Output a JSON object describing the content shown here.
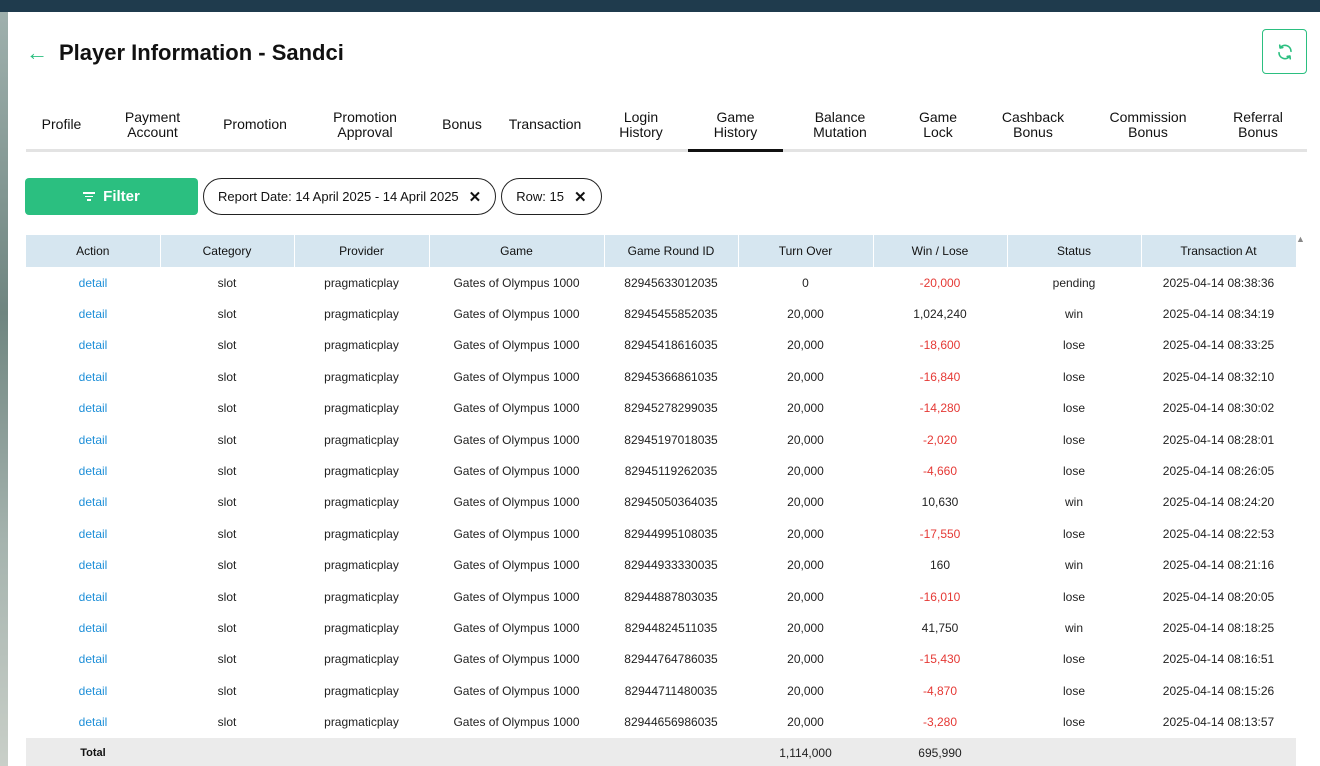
{
  "header": {
    "title": "Player Information - Sandci",
    "back_icon": "arrow-left-icon",
    "refresh_icon": "refresh-icon"
  },
  "tabs": [
    {
      "label": "Profile",
      "w": 71
    },
    {
      "label": "Payment\nAccount",
      "w": 111
    },
    {
      "label": "Promotion",
      "w": 94
    },
    {
      "label": "Promotion\nApproval",
      "w": 126
    },
    {
      "label": "Bonus",
      "w": 68
    },
    {
      "label": "Transaction",
      "w": 98
    },
    {
      "label": "Login\nHistory",
      "w": 94
    },
    {
      "label": "Game\nHistory",
      "w": 95,
      "active": true
    },
    {
      "label": "Balance\nMutation",
      "w": 114
    },
    {
      "label": "Game\nLock",
      "w": 82
    },
    {
      "label": "Cashback\nBonus",
      "w": 108
    },
    {
      "label": "Commission\nBonus",
      "w": 122
    },
    {
      "label": "Referral\nBonus",
      "w": 98
    }
  ],
  "filters": {
    "filter_label": "Filter",
    "chips": [
      "Report Date: 14 April 2025 - 14 April 2025",
      "Row: 15"
    ]
  },
  "table": {
    "columns": [
      "Action",
      "Category",
      "Provider",
      "Game",
      "Game Round ID",
      "Turn Over",
      "Win / Lose",
      "Status",
      "Transaction At"
    ],
    "rows": [
      [
        "detail",
        "slot",
        "pragmaticplay",
        "Gates of Olympus 1000",
        "82945633012035",
        "0",
        "-20,000",
        "pending",
        "2025-04-14 08:38:36"
      ],
      [
        "detail",
        "slot",
        "pragmaticplay",
        "Gates of Olympus 1000",
        "82945455852035",
        "20,000",
        "1,024,240",
        "win",
        "2025-04-14 08:34:19"
      ],
      [
        "detail",
        "slot",
        "pragmaticplay",
        "Gates of Olympus 1000",
        "82945418616035",
        "20,000",
        "-18,600",
        "lose",
        "2025-04-14 08:33:25"
      ],
      [
        "detail",
        "slot",
        "pragmaticplay",
        "Gates of Olympus 1000",
        "82945366861035",
        "20,000",
        "-16,840",
        "lose",
        "2025-04-14 08:32:10"
      ],
      [
        "detail",
        "slot",
        "pragmaticplay",
        "Gates of Olympus 1000",
        "82945278299035",
        "20,000",
        "-14,280",
        "lose",
        "2025-04-14 08:30:02"
      ],
      [
        "detail",
        "slot",
        "pragmaticplay",
        "Gates of Olympus 1000",
        "82945197018035",
        "20,000",
        "-2,020",
        "lose",
        "2025-04-14 08:28:01"
      ],
      [
        "detail",
        "slot",
        "pragmaticplay",
        "Gates of Olympus 1000",
        "82945119262035",
        "20,000",
        "-4,660",
        "lose",
        "2025-04-14 08:26:05"
      ],
      [
        "detail",
        "slot",
        "pragmaticplay",
        "Gates of Olympus 1000",
        "82945050364035",
        "20,000",
        "10,630",
        "win",
        "2025-04-14 08:24:20"
      ],
      [
        "detail",
        "slot",
        "pragmaticplay",
        "Gates of Olympus 1000",
        "82944995108035",
        "20,000",
        "-17,550",
        "lose",
        "2025-04-14 08:22:53"
      ],
      [
        "detail",
        "slot",
        "pragmaticplay",
        "Gates of Olympus 1000",
        "82944933330035",
        "20,000",
        "160",
        "win",
        "2025-04-14 08:21:16"
      ],
      [
        "detail",
        "slot",
        "pragmaticplay",
        "Gates of Olympus 1000",
        "82944887803035",
        "20,000",
        "-16,010",
        "lose",
        "2025-04-14 08:20:05"
      ],
      [
        "detail",
        "slot",
        "pragmaticplay",
        "Gates of Olympus 1000",
        "82944824511035",
        "20,000",
        "41,750",
        "win",
        "2025-04-14 08:18:25"
      ],
      [
        "detail",
        "slot",
        "pragmaticplay",
        "Gates of Olympus 1000",
        "82944764786035",
        "20,000",
        "-15,430",
        "lose",
        "2025-04-14 08:16:51"
      ],
      [
        "detail",
        "slot",
        "pragmaticplay",
        "Gates of Olympus 1000",
        "82944711480035",
        "20,000",
        "-4,870",
        "lose",
        "2025-04-14 08:15:26"
      ],
      [
        "detail",
        "slot",
        "pragmaticplay",
        "Gates of Olympus 1000",
        "82944656986035",
        "20,000",
        "-3,280",
        "lose",
        "2025-04-14 08:13:57"
      ]
    ],
    "total": {
      "label": "Total",
      "turn_over": "1,114,000",
      "win_lose": "695,990"
    }
  },
  "colors": {
    "accent": "#2bbf80",
    "link": "#1e8fd8",
    "negative": "#e53935",
    "header_bg": "#d6e6f0"
  }
}
